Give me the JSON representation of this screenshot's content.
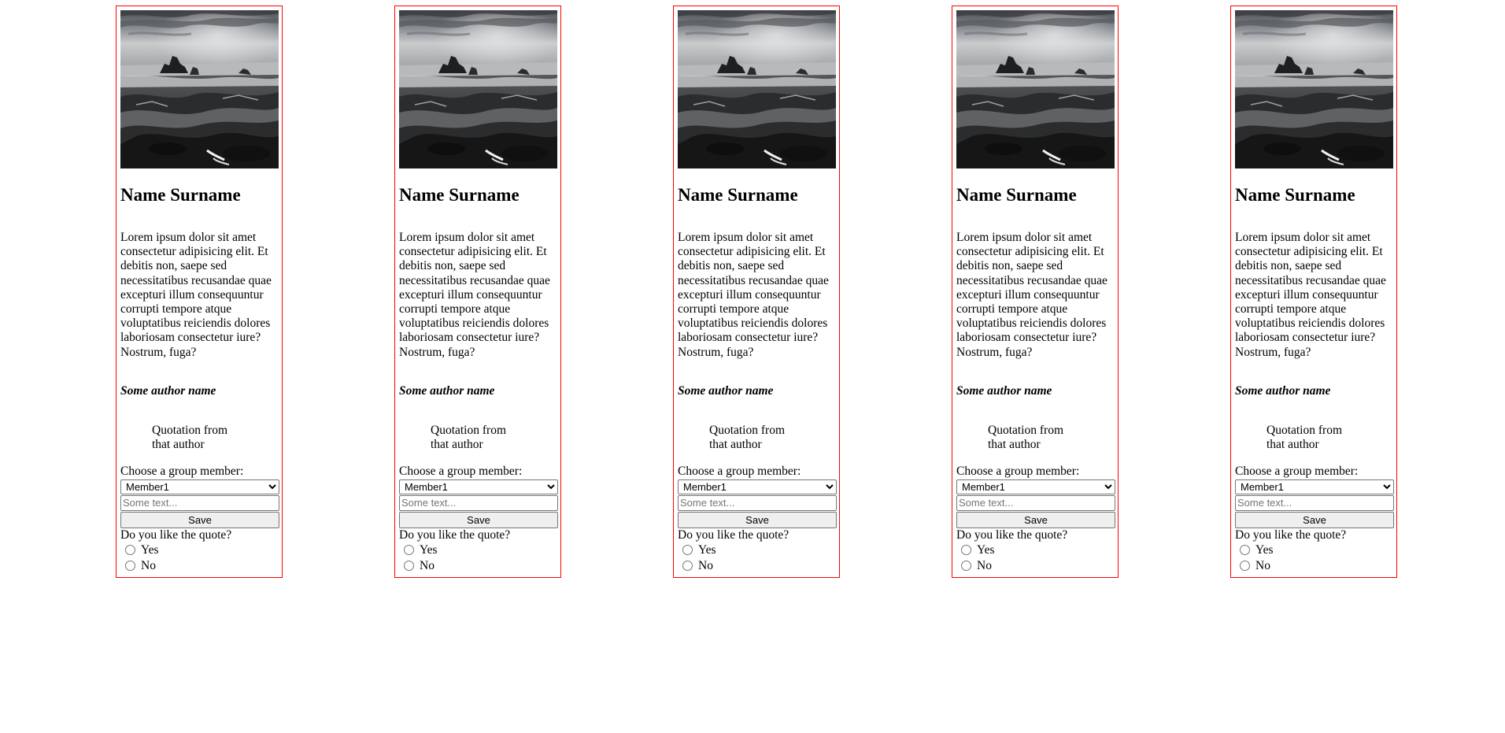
{
  "cards": [
    {
      "name": "Name Surname",
      "bio": "Lorem ipsum dolor sit amet consectetur adipisicing elit. Et debitis non, saepe sed necessitatibus recusandae quae excepturi illum consequuntur corrupti tempore atque voluptatibus reiciendis dolores laboriosam consectetur iure? Nostrum, fuga?",
      "author": "Some author name",
      "quote": "Quotation from that author",
      "choose_label": "Choose a group member:",
      "selected_member": "Member1",
      "text_placeholder": "Some text...",
      "save_label": "Save",
      "question": "Do you like the quote?",
      "yes_label": "Yes",
      "no_label": "No"
    },
    {
      "name": "Name Surname",
      "bio": "Lorem ipsum dolor sit amet consectetur adipisicing elit. Et debitis non, saepe sed necessitatibus recusandae quae excepturi illum consequuntur corrupti tempore atque voluptatibus reiciendis dolores laboriosam consectetur iure? Nostrum, fuga?",
      "author": "Some author name",
      "quote": "Quotation from that author",
      "choose_label": "Choose a group member:",
      "selected_member": "Member1",
      "text_placeholder": "Some text...",
      "save_label": "Save",
      "question": "Do you like the quote?",
      "yes_label": "Yes",
      "no_label": "No"
    },
    {
      "name": "Name Surname",
      "bio": "Lorem ipsum dolor sit amet consectetur adipisicing elit. Et debitis non, saepe sed necessitatibus recusandae quae excepturi illum consequuntur corrupti tempore atque voluptatibus reiciendis dolores laboriosam consectetur iure? Nostrum, fuga?",
      "author": "Some author name",
      "quote": "Quotation from that author",
      "choose_label": "Choose a group member:",
      "selected_member": "Member1",
      "text_placeholder": "Some text...",
      "save_label": "Save",
      "question": "Do you like the quote?",
      "yes_label": "Yes",
      "no_label": "No"
    },
    {
      "name": "Name Surname",
      "bio": "Lorem ipsum dolor sit amet consectetur adipisicing elit. Et debitis non, saepe sed necessitatibus recusandae quae excepturi illum consequuntur corrupti tempore atque voluptatibus reiciendis dolores laboriosam consectetur iure? Nostrum, fuga?",
      "author": "Some author name",
      "quote": "Quotation from that author",
      "choose_label": "Choose a group member:",
      "selected_member": "Member1",
      "text_placeholder": "Some text...",
      "save_label": "Save",
      "question": "Do you like the quote?",
      "yes_label": "Yes",
      "no_label": "No"
    },
    {
      "name": "Name Surname",
      "bio": "Lorem ipsum dolor sit amet consectetur adipisicing elit. Et debitis non, saepe sed necessitatibus recusandae quae excepturi illum consequuntur corrupti tempore atque voluptatibus reiciendis dolores laboriosam consectetur iure? Nostrum, fuga?",
      "author": "Some author name",
      "quote": "Quotation from that author",
      "choose_label": "Choose a group member:",
      "selected_member": "Member1",
      "text_placeholder": "Some text...",
      "save_label": "Save",
      "question": "Do you like the quote?",
      "yes_label": "Yes",
      "no_label": "No"
    }
  ],
  "colors": {
    "card_border": "#ff0000",
    "button_bg": "#efefef"
  }
}
